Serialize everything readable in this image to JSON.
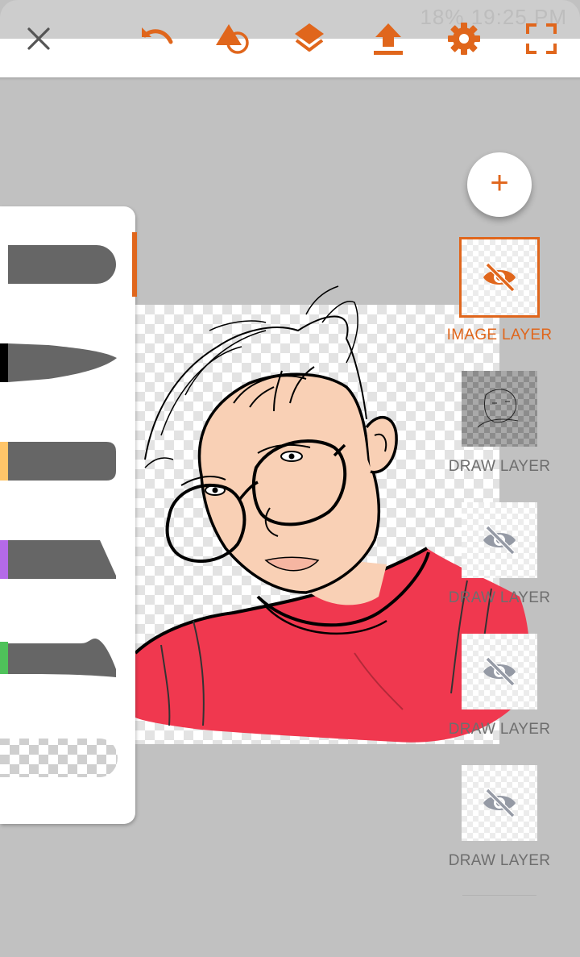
{
  "status_bar": {
    "text": "18% 19:25 PM"
  },
  "toolbar": {
    "icons": [
      "close-icon",
      "undo-icon",
      "shape-tool-icon",
      "layers-icon",
      "upload-icon",
      "settings-icon",
      "fullscreen-icon"
    ]
  },
  "colors": {
    "accent": "#e0661c",
    "shirt": "#f0384f",
    "skin": "#f9d0b5",
    "brush": "#666666"
  },
  "brushes": [
    {
      "name": "round-brush",
      "swatch": "#ffffff"
    },
    {
      "name": "ink-pen-brush",
      "swatch": "#000000"
    },
    {
      "name": "marker-brush",
      "swatch": "#ffc569"
    },
    {
      "name": "chisel-brush",
      "swatch": "#b46ae8"
    },
    {
      "name": "calligraphy-brush",
      "swatch": "#4fc25a"
    },
    {
      "name": "eraser-brush",
      "swatch": "checker"
    }
  ],
  "layers": {
    "add_label": "+",
    "items": [
      {
        "label": "IMAGE LAYER",
        "selected": true,
        "hidden": true
      },
      {
        "label": "DRAW LAYER",
        "selected": false,
        "hidden": false
      },
      {
        "label": "DRAW LAYER",
        "selected": false,
        "hidden": true
      },
      {
        "label": "DRAW LAYER",
        "selected": false,
        "hidden": true
      },
      {
        "label": "DRAW LAYER",
        "selected": false,
        "hidden": true
      }
    ]
  }
}
